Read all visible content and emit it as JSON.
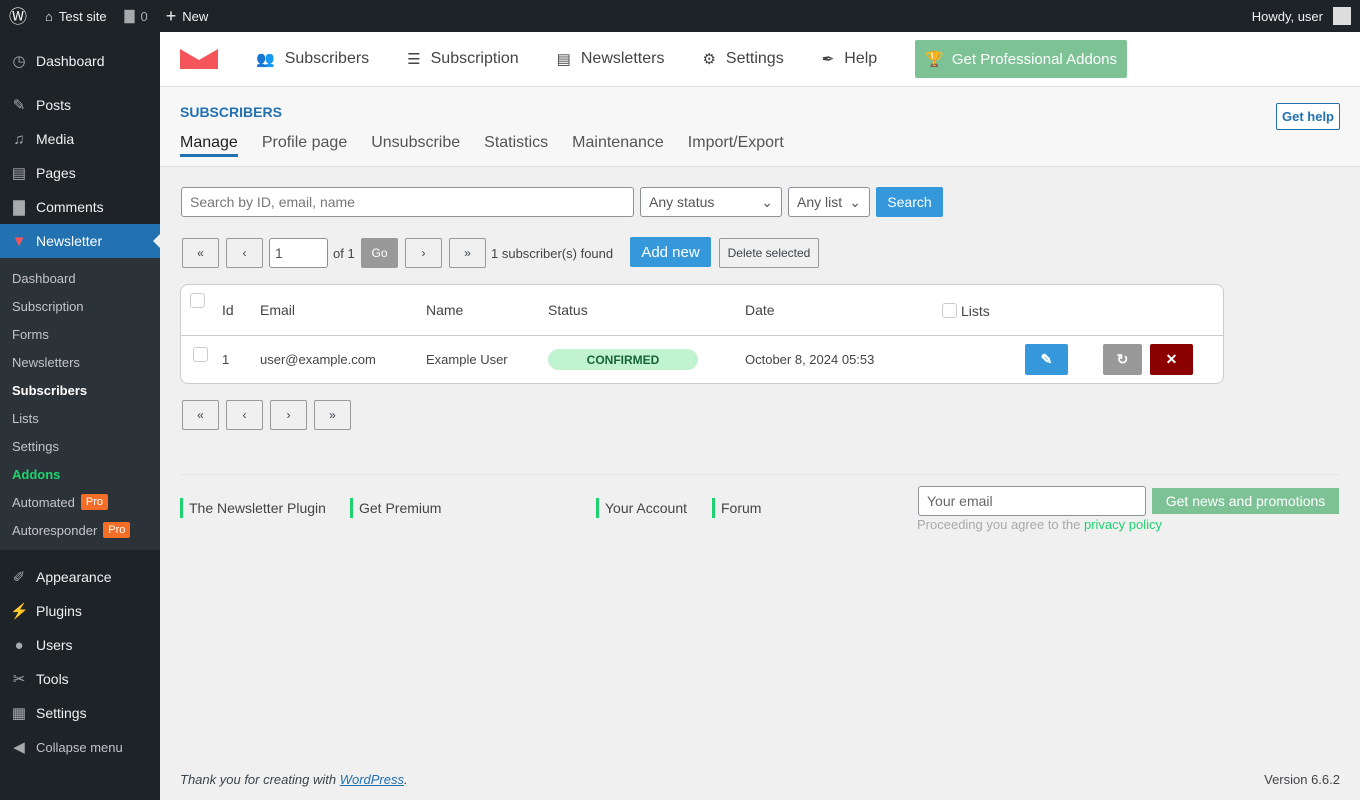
{
  "adminbar": {
    "site": "Test site",
    "comments": "0",
    "new": "New",
    "howdy": "Howdy, user"
  },
  "sidebar": {
    "items": [
      "Dashboard",
      "Posts",
      "Media",
      "Pages",
      "Comments",
      "Newsletter"
    ],
    "sub": [
      "Dashboard",
      "Subscription",
      "Forms",
      "Newsletters",
      "Subscribers",
      "Lists",
      "Settings",
      "Addons",
      "Automated",
      "Autoresponder"
    ],
    "pro": "Pro",
    "items2": [
      "Appearance",
      "Plugins",
      "Users",
      "Tools",
      "Settings",
      "Collapse menu"
    ]
  },
  "topnav": {
    "items": [
      "Subscribers",
      "Subscription",
      "Newsletters",
      "Settings",
      "Help"
    ],
    "pro": "Get Professional Addons"
  },
  "section": {
    "title": "SUBSCRIBERS",
    "get_help": "Get help",
    "tabs": [
      "Manage",
      "Profile page",
      "Unsubscribe",
      "Statistics",
      "Maintenance",
      "Import/Export"
    ]
  },
  "filters": {
    "search_placeholder": "Search by ID, email, name",
    "status": "Any status",
    "list": "Any list",
    "search": "Search"
  },
  "pager": {
    "first": "«",
    "prev": "‹",
    "next": "›",
    "last": "»",
    "page": "1",
    "of": "of 1",
    "go": "Go",
    "found": "1 subscriber(s) found",
    "add": "Add new",
    "delete": "Delete selected"
  },
  "table": {
    "headers": [
      "Id",
      "Email",
      "Name",
      "Status",
      "Date",
      "Lists"
    ],
    "rows": [
      {
        "id": "1",
        "email": "user@example.com",
        "name": "Example User",
        "status": "CONFIRMED",
        "date": "October 8, 2024 05:53"
      }
    ]
  },
  "footer": {
    "links": [
      "The Newsletter Plugin",
      "Get Premium",
      "Your Account",
      "Forum"
    ],
    "email_placeholder": "Your email",
    "promo": "Get news and promotions",
    "agree": "Proceeding you agree to the",
    "privacy": "privacy policy",
    "thanks": "Thank you for creating with",
    "wp": "WordPress",
    "version": "Version 6.6.2"
  },
  "colors": {
    "accent": "#2271b1",
    "button": "#3498db",
    "confirmed": "#c1f3d1",
    "delete": "#8b0000"
  }
}
